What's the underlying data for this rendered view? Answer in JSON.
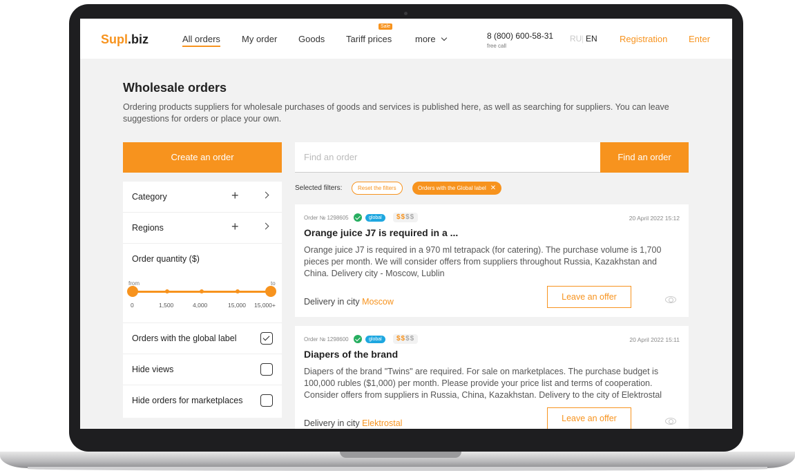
{
  "header": {
    "logo_prefix": "Supl",
    "logo_suffix": ".biz",
    "nav": [
      "All orders",
      "My order",
      "Goods",
      "Tariff prices",
      "more"
    ],
    "sale_badge": "Sale",
    "phone": "8 (800) 600-58-31",
    "phone_note": "free call",
    "lang_ru": "RU",
    "lang_en": "EN",
    "registration": "Registration",
    "enter": "Enter"
  },
  "page": {
    "title": "Wholesale orders",
    "description": "Ordering products suppliers for wholesale purchases of goods and services is published here, as well as searching for suppliers. You can leave suggestions for orders or place your own."
  },
  "actions": {
    "create_order": "Create an order",
    "search_placeholder": "Find an order",
    "search_button": "Find an order"
  },
  "sidebar": {
    "category": "Category",
    "regions": "Regions",
    "quantity_label": "Order quantity ($)",
    "range_from": "from",
    "range_to": "to",
    "range_ticks": [
      "0",
      "1,500",
      "4,000",
      "15,000",
      "15,000+"
    ],
    "checks": [
      {
        "label": "Orders with the global label",
        "checked": true
      },
      {
        "label": "Hide views",
        "checked": false
      },
      {
        "label": "Hide orders for marketplaces",
        "checked": false
      }
    ]
  },
  "filters": {
    "label": "Selected filters:",
    "reset": "Reset the filters",
    "active": "Orders with the Global label"
  },
  "orders": [
    {
      "number": "Order № 1298605",
      "badge": "global",
      "price_on": "$$",
      "price_off": "$$",
      "date": "20 April 2022 15:12",
      "title": "Orange juice J7 is required in a ...",
      "text": "Orange juice J7 is required in a 970 ml tetrapack (for catering). The purchase volume is 1,700 pieces per month. We will consider offers from suppliers throughout Russia, Kazakhstan and China. Delivery city - Moscow, Lublin",
      "city_label": "Delivery in city",
      "city": "Moscow",
      "offer": "Leave an offer"
    },
    {
      "number": "Order № 1298600",
      "badge": "global",
      "price_on": "$$",
      "price_off": "$$",
      "date": "20 April 2022 15:11",
      "title": "Diapers of the brand",
      "text": "Diapers of the brand \"Twins\" are required. For sale on marketplaces. The purchase budget is 100,000 rubles ($1,000) per month. Please provide your price list and terms of cooperation. Consider offers from suppliers in Russia, China, Kazakhstan. Delivery to the city of Elektrostal",
      "city_label": "Delivery in city",
      "city": "Elektrostal",
      "offer": "Leave an offer"
    }
  ],
  "colors": {
    "accent": "#f7931e",
    "global_badge": "#1ea7e0",
    "ok_badge": "#27ae60"
  }
}
